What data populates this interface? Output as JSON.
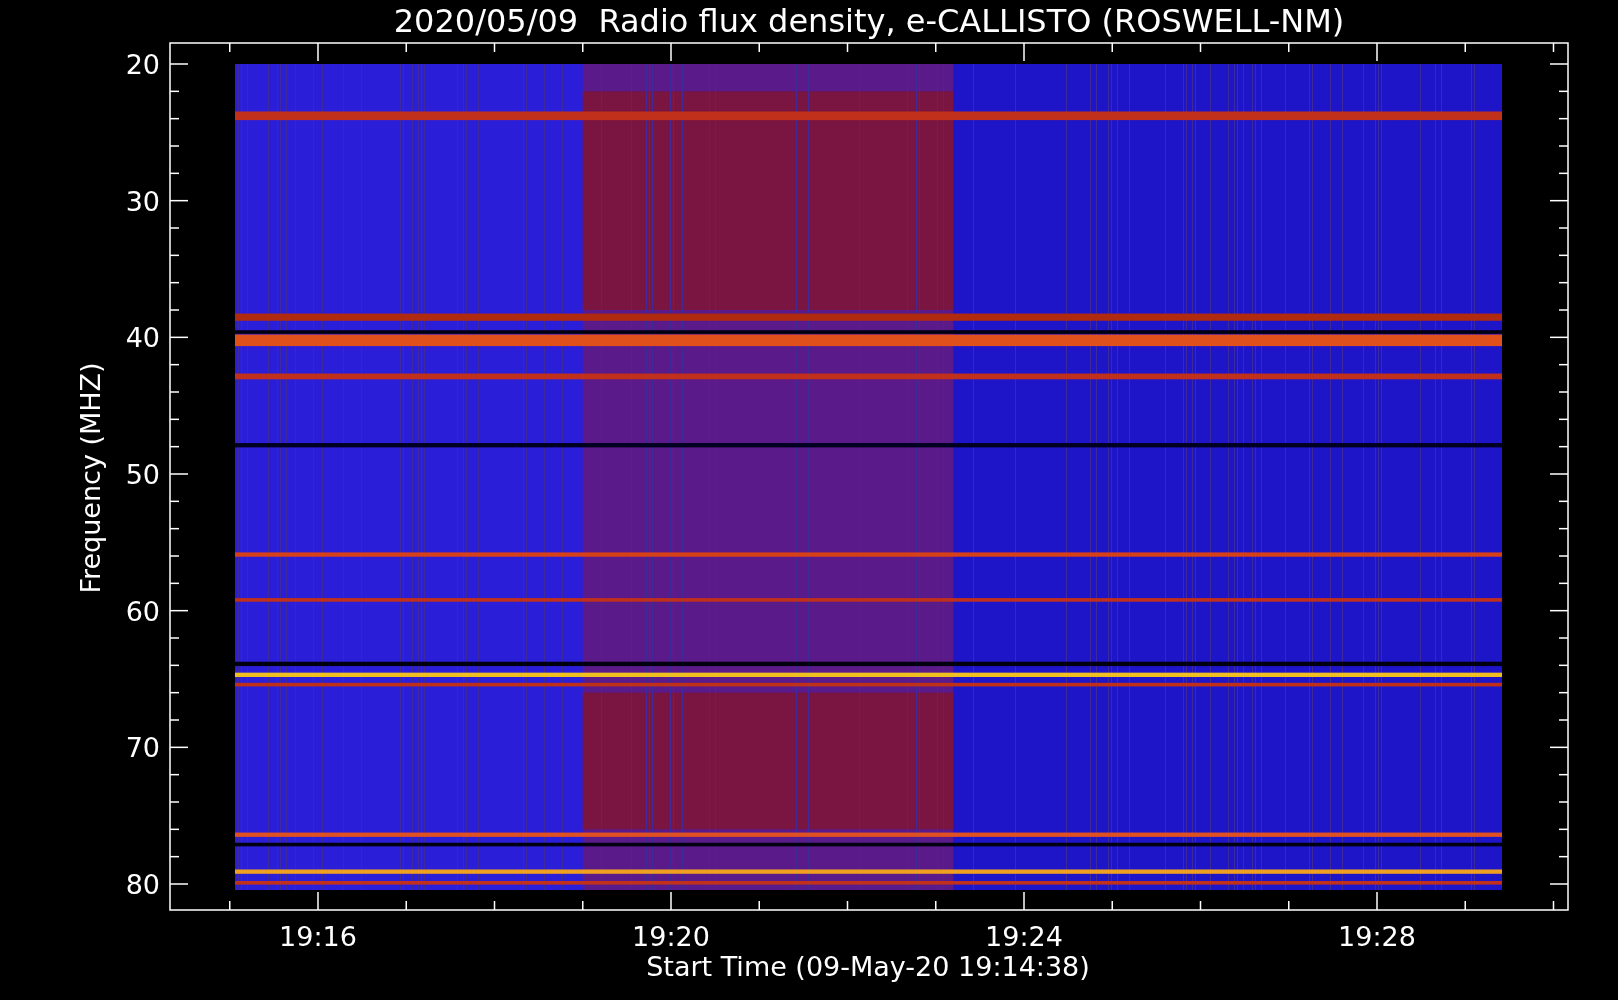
{
  "plot": {
    "title": "2020/05/09  Radio flux density, e-CALLISTO (ROSWELL-NM)",
    "y_axis_label": "Frequency (MHZ)",
    "x_axis_label": "Start Time (09-May-20 19:14:38)",
    "x_tick_labels": [
      "19:16",
      "19:20",
      "19:24",
      "19:28"
    ],
    "y_tick_labels": [
      "20",
      "30",
      "40",
      "50",
      "60",
      "70",
      "80"
    ]
  }
}
